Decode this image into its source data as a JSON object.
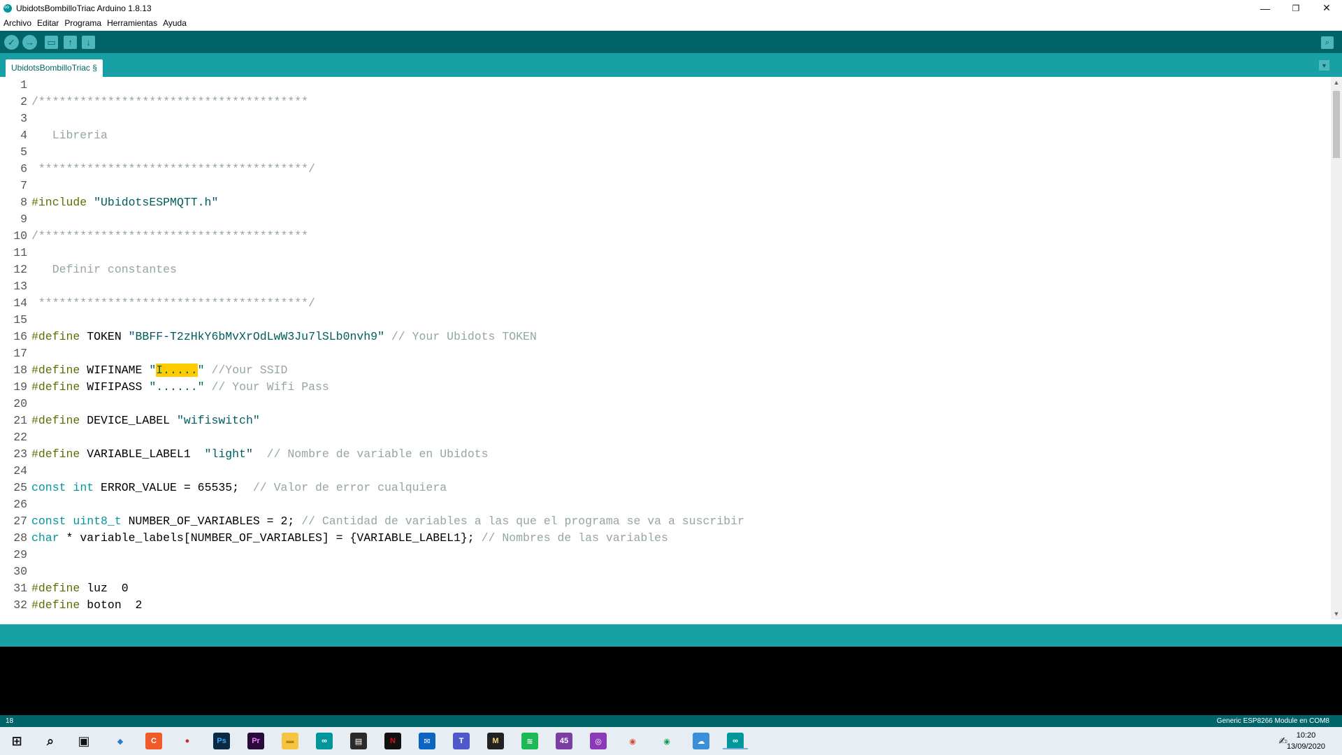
{
  "window": {
    "title": "UbidotsBombilloTriac Arduino 1.8.13",
    "minimize_glyph": "—",
    "restore_glyph": "❐",
    "close_glyph": "✕"
  },
  "menu": [
    "Archivo",
    "Editar",
    "Programa",
    "Herramientas",
    "Ayuda"
  ],
  "toolbar": {
    "verify_icon": "✓",
    "upload_icon": "→",
    "new_icon": "▭",
    "open_icon": "↑",
    "save_icon": "↓",
    "serial_icon": "⌕"
  },
  "tab": {
    "label": "UbidotsBombilloTriac §",
    "menu_glyph": "▼"
  },
  "editor": {
    "lines": [
      {
        "n": "1",
        "segs": []
      },
      {
        "n": "2",
        "segs": [
          {
            "c": "cmt",
            "t": "/***************************************"
          }
        ]
      },
      {
        "n": "3",
        "segs": []
      },
      {
        "n": "4",
        "segs": [
          {
            "c": "cmt",
            "t": "   Libreria"
          }
        ]
      },
      {
        "n": "5",
        "segs": []
      },
      {
        "n": "6",
        "segs": [
          {
            "c": "cmt",
            "t": " ***************************************/"
          }
        ]
      },
      {
        "n": "7",
        "segs": []
      },
      {
        "n": "8",
        "segs": [
          {
            "c": "kw-pre",
            "t": "#include"
          },
          {
            "c": "",
            "t": " "
          },
          {
            "c": "str",
            "t": "\"UbidotsESPMQTT.h\""
          }
        ]
      },
      {
        "n": "9",
        "segs": []
      },
      {
        "n": "10",
        "segs": [
          {
            "c": "cmt",
            "t": "/***************************************"
          }
        ]
      },
      {
        "n": "11",
        "segs": []
      },
      {
        "n": "12",
        "segs": [
          {
            "c": "cmt",
            "t": "   Definir constantes"
          }
        ]
      },
      {
        "n": "13",
        "segs": []
      },
      {
        "n": "14",
        "segs": [
          {
            "c": "cmt",
            "t": " ***************************************/"
          }
        ]
      },
      {
        "n": "15",
        "segs": []
      },
      {
        "n": "16",
        "segs": [
          {
            "c": "kw-pre",
            "t": "#define"
          },
          {
            "c": "",
            "t": " TOKEN "
          },
          {
            "c": "str",
            "t": "\"BBFF-T2zHkY6bMvXrOdLwW3Ju7lSLb0nvh9\""
          },
          {
            "c": "",
            "t": " "
          },
          {
            "c": "cmt",
            "t": "// Your Ubidots TOKEN"
          }
        ]
      },
      {
        "n": "17",
        "segs": []
      },
      {
        "n": "18",
        "segs": [
          {
            "c": "kw-pre",
            "t": "#define"
          },
          {
            "c": "",
            "t": " WIFINAME "
          },
          {
            "c": "str",
            "t": "\""
          },
          {
            "c": "str hl",
            "t": "I....."
          },
          {
            "c": "str",
            "t": "\""
          },
          {
            "c": "",
            "t": " "
          },
          {
            "c": "cmt",
            "t": "//Your SSID"
          }
        ]
      },
      {
        "n": "19",
        "segs": [
          {
            "c": "kw-pre",
            "t": "#define"
          },
          {
            "c": "",
            "t": " WIFIPASS "
          },
          {
            "c": "str",
            "t": "\"......\""
          },
          {
            "c": "",
            "t": " "
          },
          {
            "c": "cmt",
            "t": "// Your Wifi Pass"
          }
        ]
      },
      {
        "n": "20",
        "segs": []
      },
      {
        "n": "21",
        "segs": [
          {
            "c": "kw-pre",
            "t": "#define"
          },
          {
            "c": "",
            "t": " DEVICE_LABEL "
          },
          {
            "c": "str",
            "t": "\"wifiswitch\""
          }
        ]
      },
      {
        "n": "22",
        "segs": []
      },
      {
        "n": "23",
        "segs": [
          {
            "c": "kw-pre",
            "t": "#define"
          },
          {
            "c": "",
            "t": " VARIABLE_LABEL1  "
          },
          {
            "c": "str",
            "t": "\"light\""
          },
          {
            "c": "",
            "t": "  "
          },
          {
            "c": "cmt",
            "t": "// Nombre de variable en Ubidots"
          }
        ]
      },
      {
        "n": "24",
        "segs": []
      },
      {
        "n": "25",
        "segs": [
          {
            "c": "kw-type",
            "t": "const"
          },
          {
            "c": "",
            "t": " "
          },
          {
            "c": "kw-type",
            "t": "int"
          },
          {
            "c": "",
            "t": " ERROR_VALUE = 65535;  "
          },
          {
            "c": "cmt",
            "t": "// Valor de error cualquiera"
          }
        ]
      },
      {
        "n": "26",
        "segs": []
      },
      {
        "n": "27",
        "segs": [
          {
            "c": "kw-type",
            "t": "const"
          },
          {
            "c": "",
            "t": " "
          },
          {
            "c": "kw-type",
            "t": "uint8_t"
          },
          {
            "c": "",
            "t": " NUMBER_OF_VARIABLES = 2; "
          },
          {
            "c": "cmt",
            "t": "// Cantidad de variables a las que el programa se va a suscribir"
          }
        ]
      },
      {
        "n": "28",
        "segs": [
          {
            "c": "kw-type",
            "t": "char"
          },
          {
            "c": "",
            "t": " * variable_labels[NUMBER_OF_VARIABLES] = {VARIABLE_LABEL1}; "
          },
          {
            "c": "cmt",
            "t": "// Nombres de las variables"
          }
        ]
      },
      {
        "n": "29",
        "segs": []
      },
      {
        "n": "30",
        "segs": []
      },
      {
        "n": "31",
        "segs": [
          {
            "c": "kw-pre",
            "t": "#define"
          },
          {
            "c": "",
            "t": " luz  0"
          }
        ]
      },
      {
        "n": "32",
        "segs": [
          {
            "c": "kw-pre",
            "t": "#define"
          },
          {
            "c": "",
            "t": " boton  2"
          }
        ]
      }
    ]
  },
  "scrollbar": {
    "up_glyph": "▲",
    "down_glyph": "▼"
  },
  "status": {
    "line": "18",
    "board": "Generic ESP8266 Module en COM8"
  },
  "taskbar": {
    "apps": [
      {
        "name": "start-icon",
        "glyph": "⊞",
        "bg": "transparent",
        "fg": "#111"
      },
      {
        "name": "search-icon",
        "glyph": "⌕",
        "bg": "transparent",
        "fg": "#111"
      },
      {
        "name": "task-view-icon",
        "glyph": "▣",
        "bg": "transparent",
        "fg": "#111"
      },
      {
        "name": "browser-icon",
        "glyph": "◆",
        "bg": "transparent",
        "fg": "#2a7bd1"
      },
      {
        "name": "app-orange-icon",
        "glyph": "C",
        "bg": "#f05a28",
        "fg": "#fff"
      },
      {
        "name": "app-red-icon",
        "glyph": "●",
        "bg": "transparent",
        "fg": "#c92a2a"
      },
      {
        "name": "photoshop-icon",
        "glyph": "Ps",
        "bg": "#0b2a44",
        "fg": "#31a8ff"
      },
      {
        "name": "premiere-icon",
        "glyph": "Pr",
        "bg": "#2a0a3a",
        "fg": "#e77cff"
      },
      {
        "name": "file-explorer-icon",
        "glyph": "▬",
        "bg": "#f5c542",
        "fg": "#b8860b"
      },
      {
        "name": "arduino-icon",
        "glyph": "∞",
        "bg": "#00979c",
        "fg": "#fff"
      },
      {
        "name": "store-icon",
        "glyph": "▤",
        "bg": "#2b2b2b",
        "fg": "#fff"
      },
      {
        "name": "netflix-icon",
        "glyph": "N",
        "bg": "#111",
        "fg": "#e50914"
      },
      {
        "name": "mail-icon",
        "glyph": "✉",
        "bg": "#0a64c2",
        "fg": "#fff"
      },
      {
        "name": "teams-icon",
        "glyph": "T",
        "bg": "#5059c9",
        "fg": "#fff"
      },
      {
        "name": "notes-icon",
        "glyph": "M",
        "bg": "#222",
        "fg": "#f5d76e"
      },
      {
        "name": "spotify-icon",
        "glyph": "≋",
        "bg": "#1db954",
        "fg": "#fff"
      },
      {
        "name": "app-purple-icon",
        "glyph": "45",
        "bg": "#7b3fa3",
        "fg": "#fff"
      },
      {
        "name": "instagram-icon",
        "glyph": "◎",
        "bg": "#8a3ab9",
        "fg": "#fff"
      },
      {
        "name": "chrome-icon",
        "glyph": "◉",
        "bg": "transparent",
        "fg": "#db4437"
      },
      {
        "name": "chrome-profile-icon",
        "glyph": "◉",
        "bg": "transparent",
        "fg": "#0f9d58"
      },
      {
        "name": "cloud-app-icon",
        "glyph": "☁",
        "bg": "#3b8fd9",
        "fg": "#fff"
      },
      {
        "name": "arduino-active-icon",
        "glyph": "∞",
        "bg": "#00979c",
        "fg": "#fff"
      }
    ],
    "pen_glyph": "✍",
    "time": "10:20",
    "date": "13/09/2020"
  }
}
